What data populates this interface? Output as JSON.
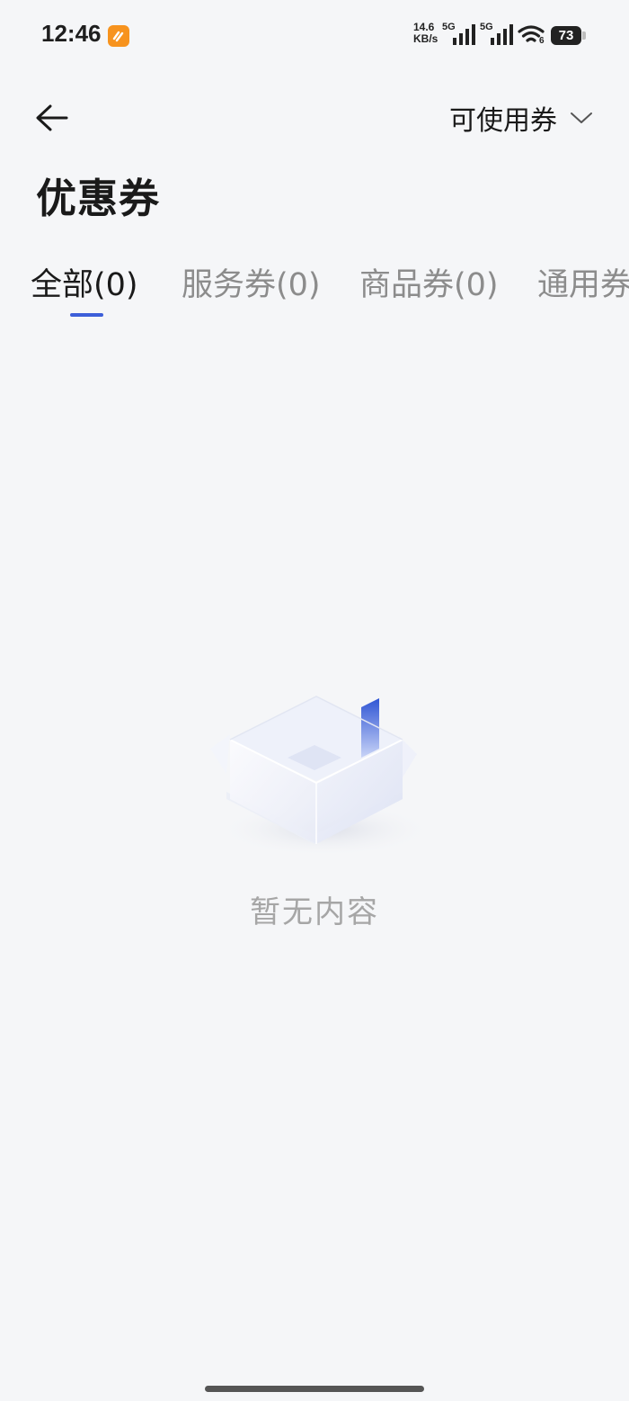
{
  "status_bar": {
    "time": "12:46",
    "net_speed_value": "14.6",
    "net_speed_unit": "KB/s",
    "sim1_label": "5G",
    "sim2_label": "5G",
    "wifi_label": "6",
    "battery": "73"
  },
  "header": {
    "back_icon": "arrow-left-icon",
    "filter_label": "可使用券",
    "filter_icon": "chevron-down-icon",
    "title": "优惠券"
  },
  "tabs": [
    {
      "label": "全部(0)",
      "active": true
    },
    {
      "label": "服务券(0)",
      "active": false
    },
    {
      "label": "商品券(0)",
      "active": false
    },
    {
      "label": "通用券",
      "active": false
    }
  ],
  "empty_state": {
    "icon": "empty-box-icon",
    "text": "暂无内容"
  },
  "colors": {
    "accent": "#3d5fd9",
    "background": "#f5f6f8",
    "muted_text": "#8c8c8c",
    "app_badge": "#f7931e"
  }
}
